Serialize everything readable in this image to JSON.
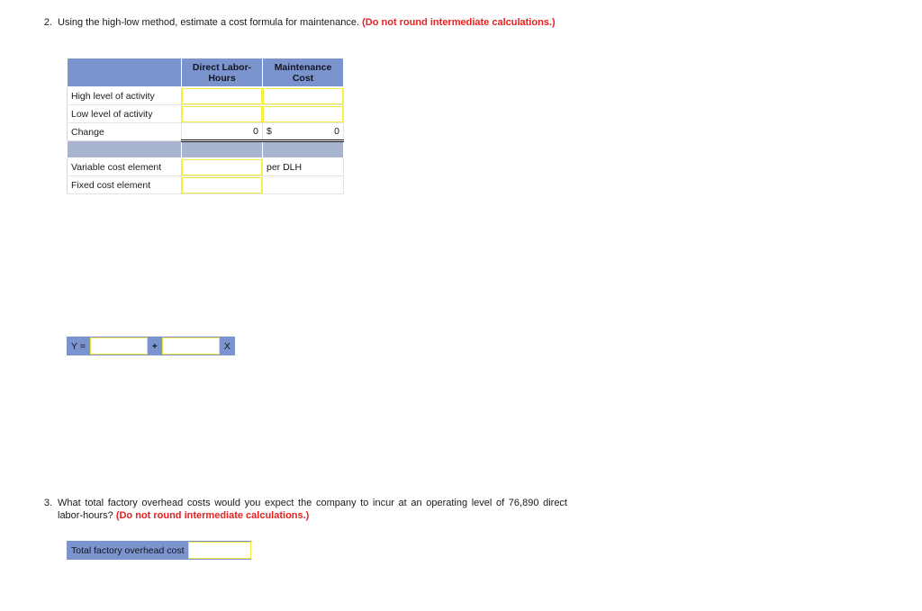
{
  "question2": {
    "number": "2.",
    "text_main": "Using the high-low method, estimate a cost formula for maintenance. ",
    "text_emph": "(Do not round intermediate calculations.)"
  },
  "question3": {
    "number": "3.",
    "text_main": "What total factory overhead costs would you expect the company to incur at an operating level of 76,890 direct labor-hours? ",
    "text_emph": "(Do not round intermediate calculations.)"
  },
  "high_low_table": {
    "headers": {
      "label": "",
      "dlh": "Direct Labor-Hours",
      "maintenance": "Maintenance Cost"
    },
    "rows": [
      {
        "label": "High level of activity",
        "dlh_value": "",
        "mc_value": "",
        "type": "input"
      },
      {
        "label": "Low level of activity",
        "dlh_value": "",
        "mc_value": "",
        "type": "input"
      },
      {
        "label": "Change",
        "dlh_value": "0",
        "mc_currency": "$",
        "mc_value": "0",
        "type": "change"
      },
      {
        "label": "",
        "type": "band"
      },
      {
        "label": "Variable cost element",
        "dlh_value": "",
        "mc_value": "per DLH",
        "type": "variable"
      },
      {
        "label": "Fixed cost element",
        "dlh_value": "",
        "mc_value": "",
        "type": "fixed"
      }
    ]
  },
  "formula": {
    "y_label": "Y =",
    "intercept_value": "",
    "operator": "+",
    "slope_value": "",
    "x_label": "X"
  },
  "total_overhead": {
    "label": "Total factory overhead cost",
    "value": ""
  },
  "colors": {
    "header_blue": "#7b94cd",
    "band_blue": "#a8b4d0",
    "input_yellow": "#f2ea3c",
    "emphasis_red": "#e8201f",
    "text": "#1a1a1a"
  }
}
